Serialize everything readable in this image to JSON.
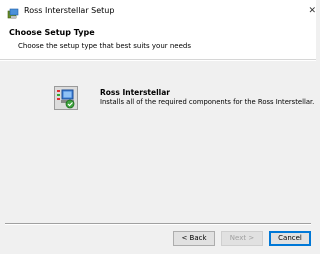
{
  "window": {
    "title": "Ross Interstellar Setup",
    "close_glyph": "✕"
  },
  "banner": {
    "title": "Choose Setup Type",
    "subtitle": "Choose the setup type that best suits your needs"
  },
  "option": {
    "icon": "installer-package-icon",
    "title": "Ross Interstellar",
    "description": "Installs all of the required components for the Ross Interstellar."
  },
  "buttons": {
    "back": "< Back",
    "next": "Next >",
    "cancel": "Cancel"
  },
  "colors": {
    "focus_border": "#0078d7",
    "disabled_text": "#a0a0a0"
  }
}
